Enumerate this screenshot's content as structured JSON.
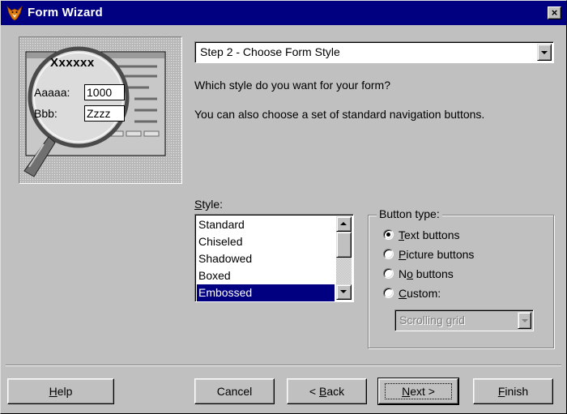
{
  "window": {
    "title": "Form Wizard",
    "close_glyph": "×",
    "app_icon": "fox-icon"
  },
  "preview": {
    "title": "Xxxxxx",
    "field1_label": "Aaaaa:",
    "field1_value": "1000",
    "field2_label": "Bbb:",
    "field2_value": "Zzzz"
  },
  "step_dropdown": {
    "value": "Step 2 - Choose Form Style"
  },
  "instructions": {
    "line1": "Which style do you want for your form?",
    "line2": "You can also choose a set of standard navigation buttons."
  },
  "style_list": {
    "label_mnemonic": "S",
    "label_rest": "tyle:",
    "items": [
      "Standard",
      "Chiseled",
      "Shadowed",
      "Boxed",
      "Embossed"
    ],
    "selected": "Embossed"
  },
  "button_type": {
    "title": "Button type:",
    "options": [
      {
        "pre": "",
        "key": "T",
        "post": "ext buttons",
        "checked": true
      },
      {
        "pre": "",
        "key": "P",
        "post": "icture buttons",
        "checked": false
      },
      {
        "pre": "N",
        "key": "o",
        "post": " buttons",
        "checked": false
      },
      {
        "pre": "",
        "key": "C",
        "post": "ustom:",
        "checked": false
      }
    ],
    "custom_dropdown_value": "Scrolling grid"
  },
  "buttons": {
    "help_key": "H",
    "help_rest": "elp",
    "cancel": "Cancel",
    "back_pre": "< ",
    "back_key": "B",
    "back_rest": "ack",
    "next_key": "N",
    "next_rest": "ext >",
    "finish_key": "F",
    "finish_rest": "inish"
  },
  "colors": {
    "titlebar": "#000080",
    "face": "#c0c0c0",
    "selection": "#000080"
  }
}
